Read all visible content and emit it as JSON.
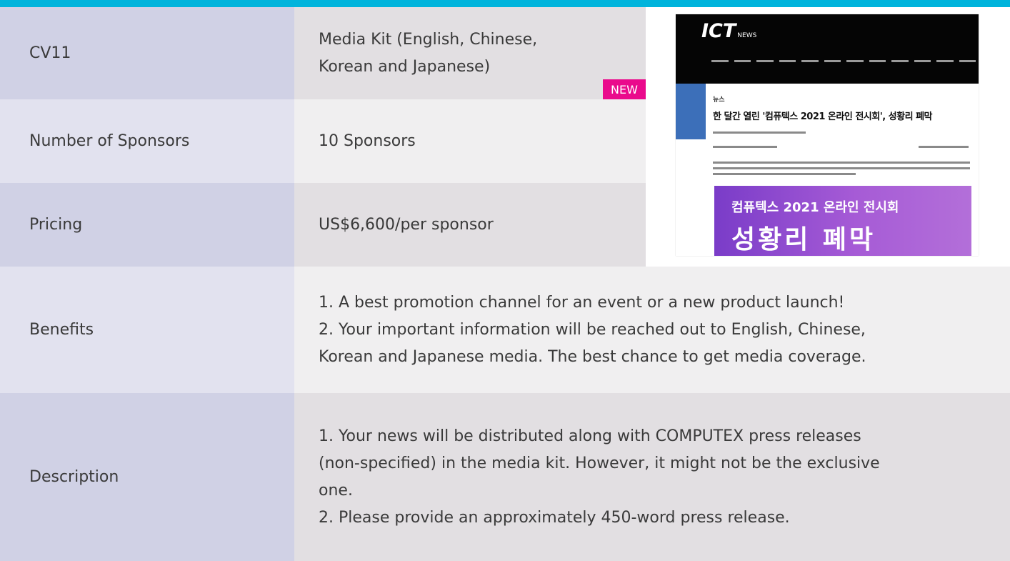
{
  "rows": {
    "cv": {
      "label": "CV11",
      "value_lines": [
        "Media Kit (English, Chinese,",
        "Korean and Japanese)"
      ],
      "badge": "NEW"
    },
    "sponsors": {
      "label": "Number of Sponsors",
      "value": "10 Sponsors"
    },
    "pricing": {
      "label": "Pricing",
      "value": "US$6,600/per sponsor"
    },
    "benefits": {
      "label": "Benefits",
      "lines": [
        "1. A  best promotion channel for an event or a new product launch!",
        "2. Your important information will be reached out to English, Chinese,",
        "Korean and Japanese media. The best chance to get media coverage."
      ]
    },
    "description": {
      "label": "Description",
      "lines": [
        "1. Your news will be distributed along with COMPUTEX press releases",
        "(non-specified) in the media kit. However, it  might not be the exclusive",
        "one.",
        "2. Please provide an approximately 450-word press release."
      ]
    }
  },
  "screenshot": {
    "logo": "ICT",
    "logo_sub": "NEWS",
    "section": "뉴스",
    "headline": "한 달간 열린 '컴퓨텍스 2021 온라인 전시회', 성황리 폐막",
    "banner_line1": "컴퓨텍스 2021 온라인 전시회",
    "banner_line2": "성황리 폐막"
  },
  "colors": {
    "accent_bar": "#00b4dc",
    "badge": "#ea0a8c",
    "label_bg": "#d0d1e5",
    "value_bg": "#e2dfe2"
  }
}
